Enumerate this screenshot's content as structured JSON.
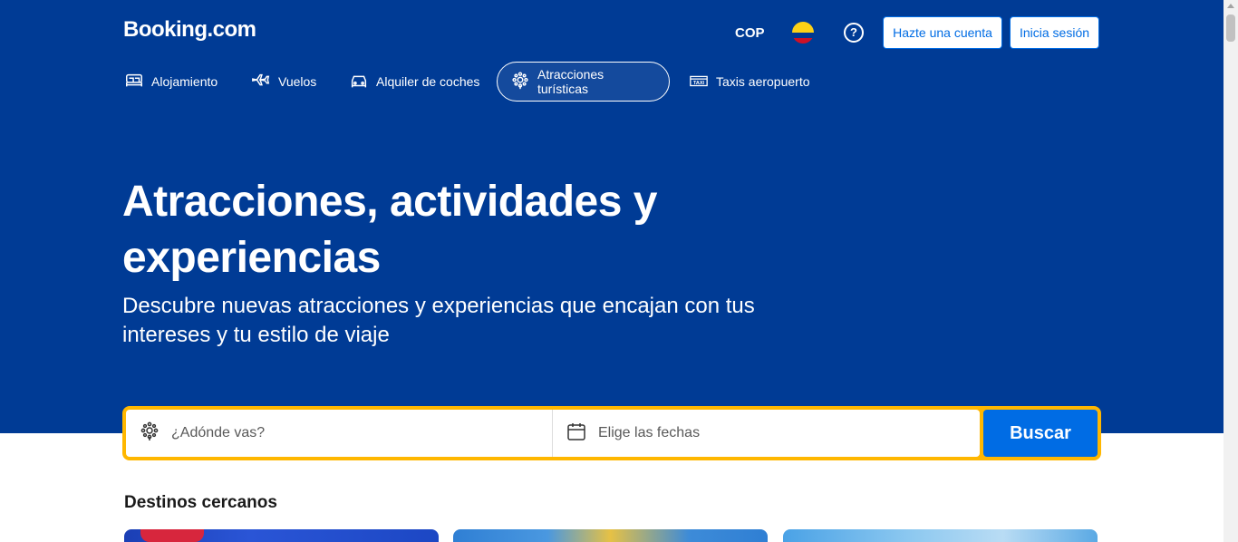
{
  "header": {
    "logo": "Booking.com",
    "currency": "COP",
    "flag_icon": "colombia-flag-icon",
    "help_icon": "question-icon",
    "register_label": "Hazte una cuenta",
    "login_label": "Inicia sesión"
  },
  "nav": {
    "items": [
      {
        "label": "Alojamiento",
        "icon": "bed-icon"
      },
      {
        "label": "Vuelos",
        "icon": "plane-icon"
      },
      {
        "label": "Alquiler de coches",
        "icon": "car-icon"
      },
      {
        "label": "Atracciones turísticas",
        "icon": "attractions-icon",
        "active": true
      },
      {
        "label": "Taxis aeropuerto",
        "icon": "taxi-icon"
      }
    ]
  },
  "hero": {
    "title": "Atracciones, actividades y experiencias",
    "subtitle": "Descubre nuevas atracciones y experiencias que encajan con tus intereses y tu estilo de viaje"
  },
  "search": {
    "destination_placeholder": "¿Adónde vas?",
    "dates_placeholder": "Elige las fechas",
    "button_label": "Buscar"
  },
  "section": {
    "title": "Destinos cercanos"
  },
  "colors": {
    "brand_blue": "#003b95",
    "action_blue": "#006ce4",
    "search_border": "#ffb700"
  }
}
